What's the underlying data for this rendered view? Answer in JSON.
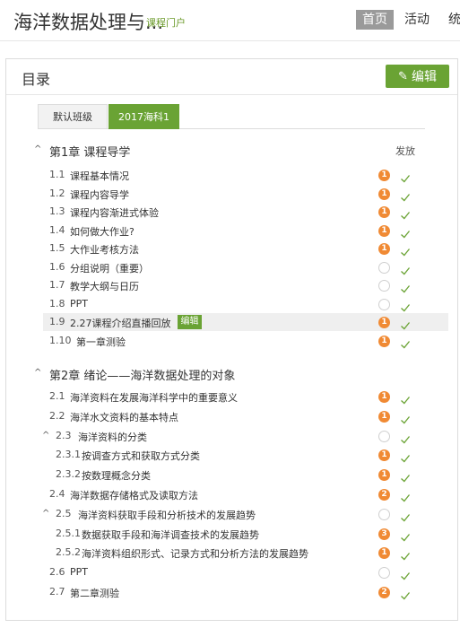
{
  "header": {
    "course_title": "海洋数据处理与...",
    "portal_link": "课程门户",
    "nav": [
      "首页",
      "活动",
      "统"
    ]
  },
  "panel": {
    "title": "目录",
    "edit_button": "编辑",
    "tabs": [
      "默认班级",
      "2017海科1"
    ],
    "column_label": "发放"
  },
  "chapters": [
    {
      "title": "第1章 课程导学",
      "items": [
        {
          "num": "1.1",
          "title": "课程基本情况",
          "badge": "1"
        },
        {
          "num": "1.2",
          "title": "课程内容导学",
          "badge": "1"
        },
        {
          "num": "1.3",
          "title": "课程内容渐进式体验",
          "badge": "1"
        },
        {
          "num": "1.4",
          "title": "如何做大作业?",
          "badge": "1"
        },
        {
          "num": "1.5",
          "title": "大作业考核方法",
          "badge": "1"
        },
        {
          "num": "1.6",
          "title": "分组说明（重要）",
          "badge": ""
        },
        {
          "num": "1.7",
          "title": "教学大纲与日历",
          "badge": ""
        },
        {
          "num": "1.8",
          "title": "PPT",
          "badge": ""
        },
        {
          "num": "1.9",
          "title": "2.27课程介绍直播回放",
          "badge": "1",
          "edit": "编辑"
        },
        {
          "num": "1.10",
          "title": "第一章测验",
          "badge": "1"
        }
      ]
    },
    {
      "title": "第2章 绪论——海洋数据处理的对象",
      "items": [
        {
          "num": "2.1",
          "title": "海洋资料在发展海洋科学中的重要意义",
          "badge": "1"
        },
        {
          "num": "2.2",
          "title": "海洋水文资料的基本特点",
          "badge": "1"
        },
        {
          "num": "2.3",
          "title": "海洋资料的分类",
          "badge": ""
        },
        {
          "num": "2.3.1",
          "title": "按调查方式和获取方式分类",
          "badge": "1"
        },
        {
          "num": "2.3.2",
          "title": "按数理概念分类",
          "badge": "1"
        },
        {
          "num": "2.4",
          "title": "海洋数据存储格式及读取方法",
          "badge": "2"
        },
        {
          "num": "2.5",
          "title": "海洋资料获取手段和分析技术的发展趋势",
          "badge": ""
        },
        {
          "num": "2.5.1",
          "title": "数据获取手段和海洋调查技术的发展趋势",
          "badge": "3"
        },
        {
          "num": "2.5.2",
          "title": "海洋资料组织形式、记录方式和分析方法的发展趋势",
          "badge": "1"
        },
        {
          "num": "2.6",
          "title": "PPT",
          "badge": ""
        },
        {
          "num": "2.7",
          "title": "第二章测验",
          "badge": "2"
        }
      ]
    }
  ],
  "colors": {
    "accent_green": "#6aa334",
    "badge_orange": "#f08a34",
    "nav_active_bg": "#9a9a9a"
  }
}
